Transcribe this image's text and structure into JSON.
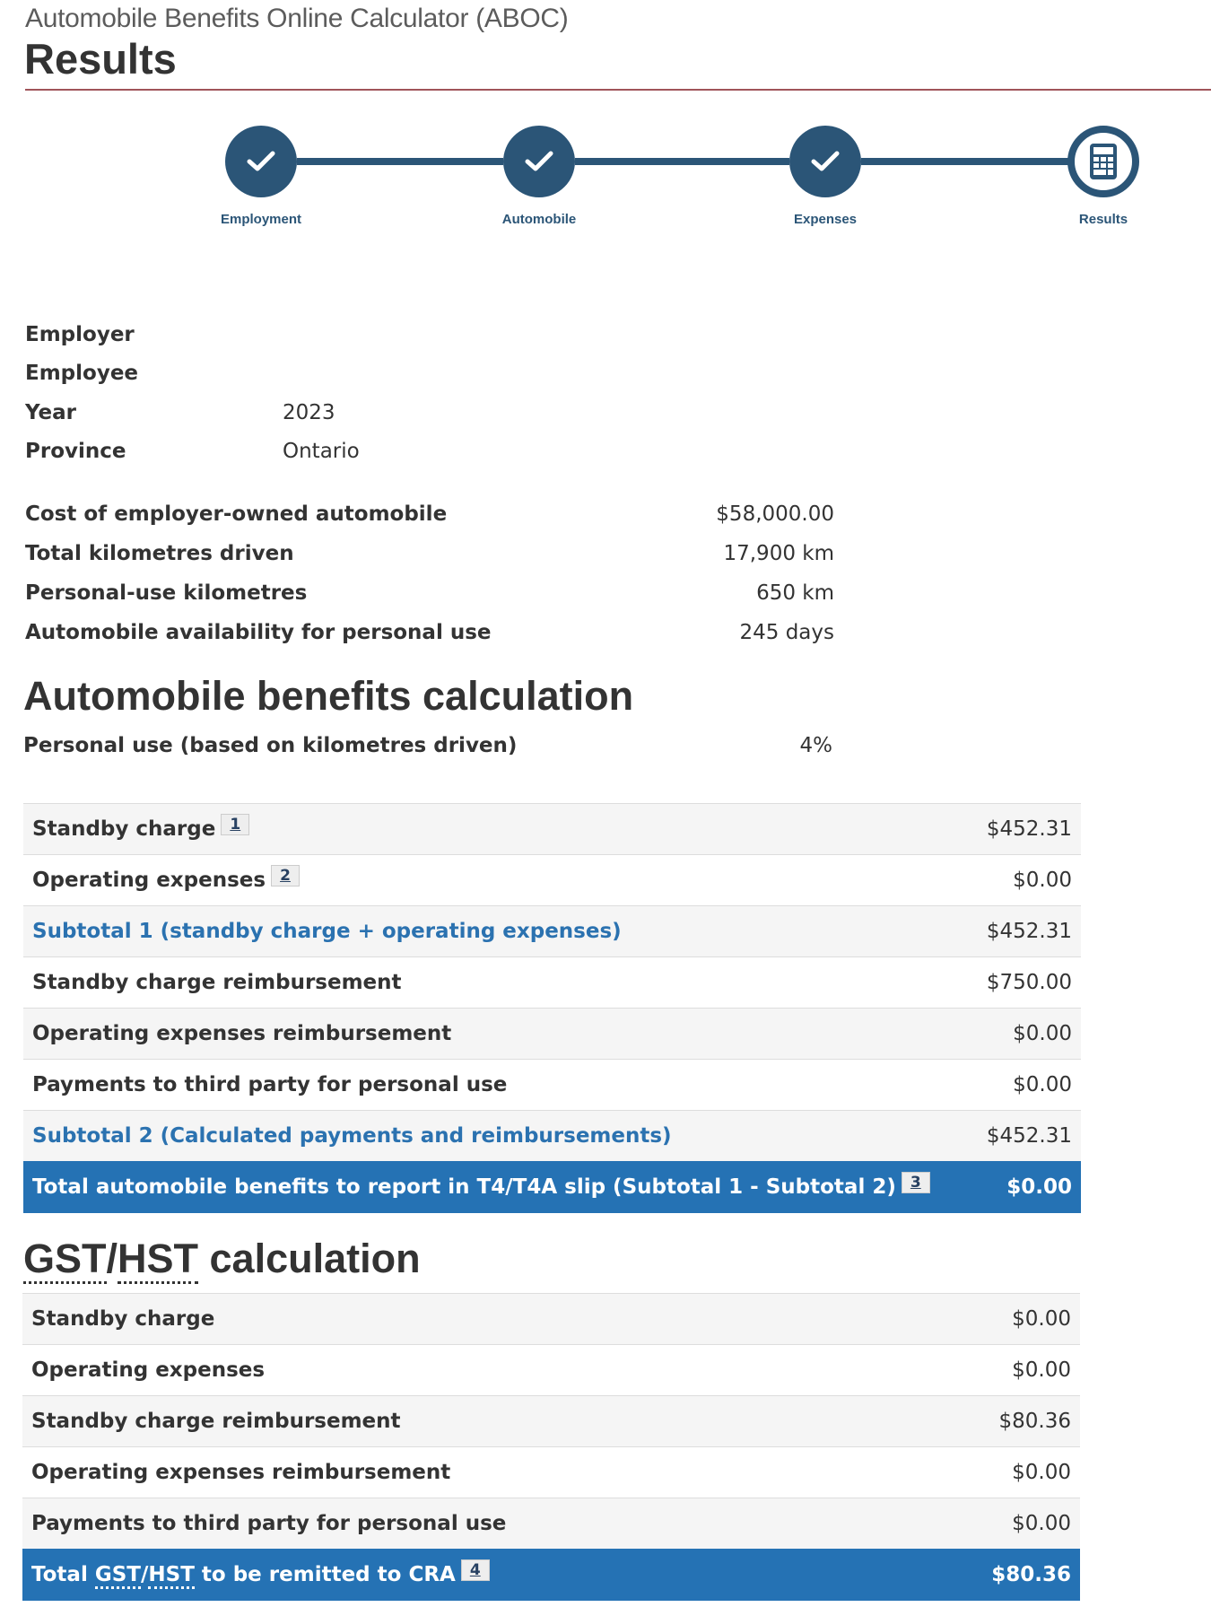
{
  "header": {
    "app_title": "Automobile Benefits Online Calculator (ABOC)",
    "page_title": "Results"
  },
  "stepper": {
    "steps": [
      {
        "label": "Employment",
        "status": "complete",
        "icon": "checkmark-icon"
      },
      {
        "label": "Automobile",
        "status": "complete",
        "icon": "checkmark-icon"
      },
      {
        "label": "Expenses",
        "status": "complete",
        "icon": "checkmark-icon"
      },
      {
        "label": "Results",
        "status": "current",
        "icon": "calculator-icon"
      }
    ],
    "color": "#2b5577"
  },
  "info": {
    "employer": {
      "label": "Employer",
      "value": ""
    },
    "employee": {
      "label": "Employee",
      "value": ""
    },
    "year": {
      "label": "Year",
      "value": "2023"
    },
    "province": {
      "label": "Province",
      "value": "Ontario"
    }
  },
  "vehicle": {
    "cost": {
      "label": "Cost of employer-owned automobile",
      "value": "$58,000.00"
    },
    "total_km": {
      "label": "Total kilometres driven",
      "value": "17,900 km"
    },
    "personal_km": {
      "label": "Personal-use kilometres",
      "value": "650 km"
    },
    "availability": {
      "label": "Automobile availability for personal use",
      "value": "245 days"
    }
  },
  "benefits": {
    "heading": "Automobile benefits calculation",
    "personal_use": {
      "label": "Personal use (based on kilometres driven)",
      "value": "4%"
    },
    "rows": [
      {
        "label": "Standby charge",
        "value": "$452.31",
        "footnote": "1"
      },
      {
        "label": "Operating expenses",
        "value": "$0.00",
        "footnote": "2"
      },
      {
        "label": "Subtotal 1 (standby charge + operating expenses)",
        "value": "$452.31"
      },
      {
        "label": "Standby charge reimbursement",
        "value": "$750.00"
      },
      {
        "label": "Operating expenses reimbursement",
        "value": "$0.00"
      },
      {
        "label": "Payments to third party for personal use",
        "value": "$0.00"
      },
      {
        "label": "Subtotal 2 (Calculated payments and reimbursements)",
        "value": "$452.31"
      }
    ],
    "total": {
      "label": "Total automobile benefits to report in T4/T4A slip (Subtotal 1 - Subtotal 2)",
      "value": "$0.00",
      "footnote": "3"
    }
  },
  "gst": {
    "heading_abbr_1": "GST",
    "heading_sep": "/",
    "heading_abbr_2": "HST",
    "heading_rest": " calculation",
    "rows": [
      {
        "label": "Standby charge",
        "value": "$0.00"
      },
      {
        "label": "Operating expenses",
        "value": "$0.00"
      },
      {
        "label": "Standby charge reimbursement",
        "value": "$80.36"
      },
      {
        "label": "Operating expenses reimbursement",
        "value": "$0.00"
      },
      {
        "label": "Payments to third party for personal use",
        "value": "$0.00"
      }
    ],
    "total": {
      "label_prefix": "Total ",
      "abbr_1": "GST",
      "sep": "/",
      "abbr_2": "HST",
      "label_suffix": " to be remitted to CRA",
      "value": "$80.36",
      "footnote": "4"
    }
  },
  "colors": {
    "accent_blue": "#2572b4",
    "subtotal_blue": "#2b72b0",
    "stepper": "#2b5577",
    "divider": "#a0545a"
  }
}
